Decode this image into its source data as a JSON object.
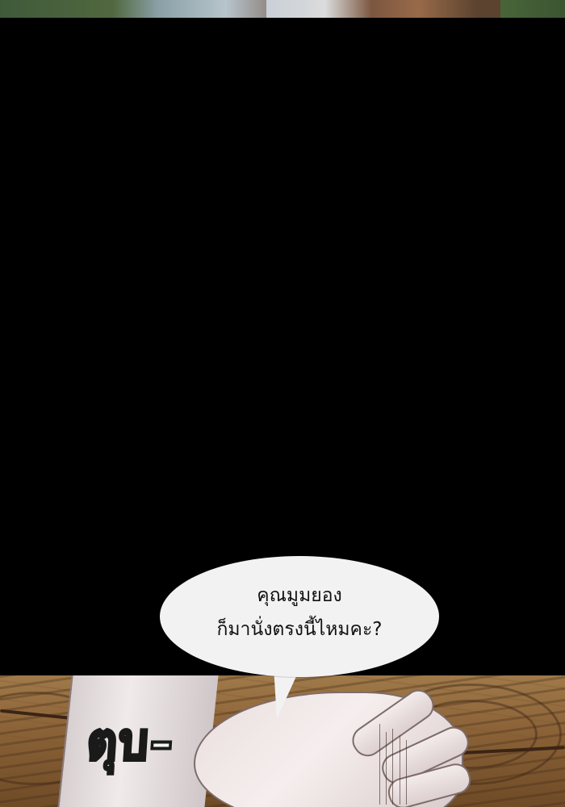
{
  "speech_bubble": {
    "line1": "คุณมูมยอง",
    "line2": "ก็มานั่งตรงนี้ไหมคะ?"
  },
  "sound_effect": {
    "text": "ตุบ–"
  }
}
